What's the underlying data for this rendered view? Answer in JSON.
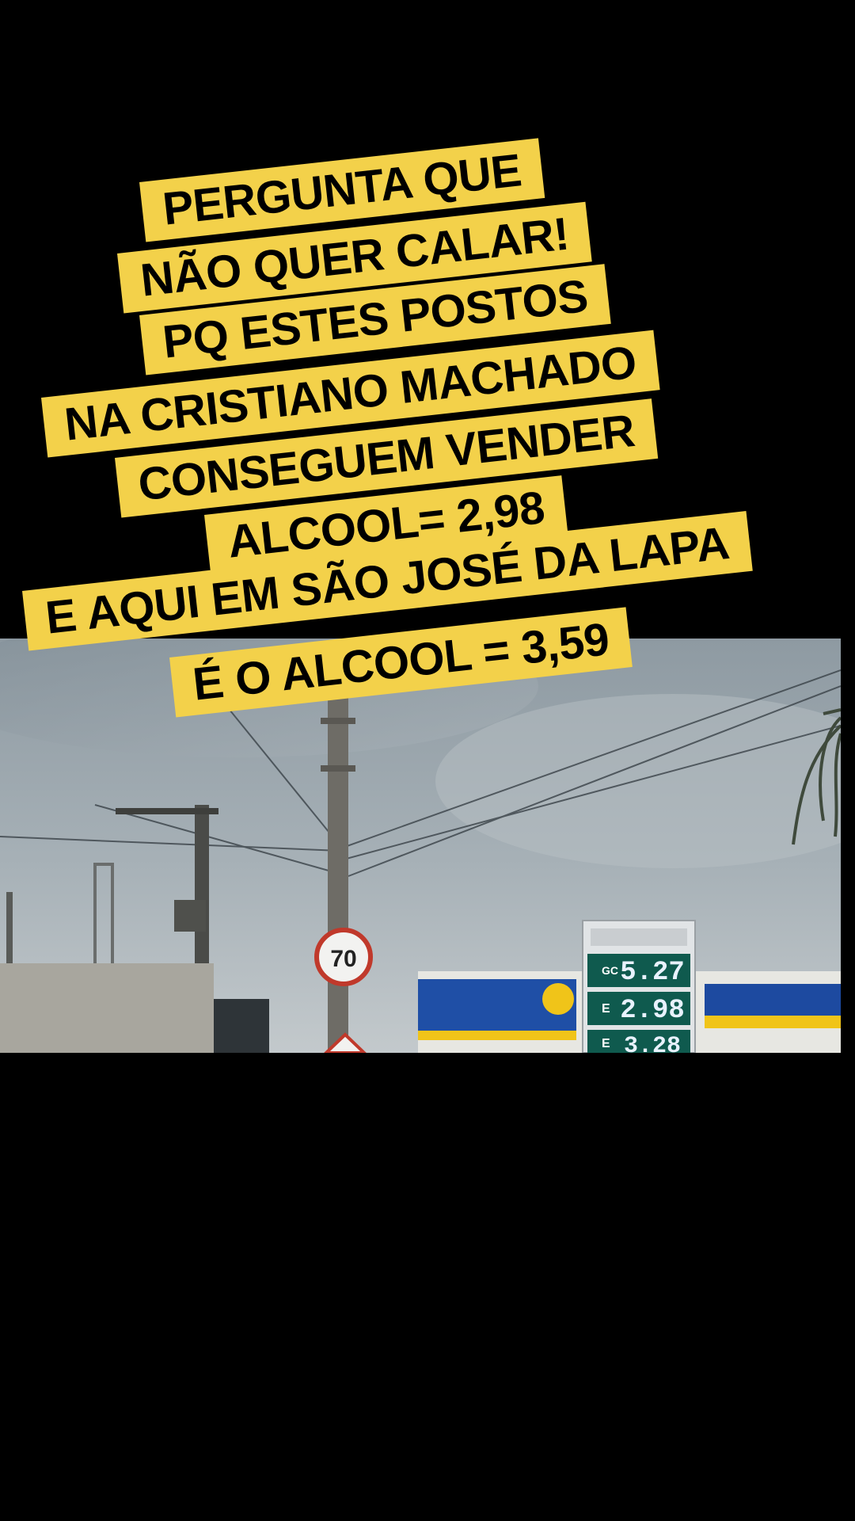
{
  "caption": {
    "lines": [
      "PERGUNTA QUE",
      "NÃO QUER CALAR!",
      "PQ ESTES POSTOS",
      "NA CRISTIANO MACHADO",
      "CONSEGUEM VENDER",
      "ALCOOL= 2,98",
      "E AQUI EM SÃO JOSÉ DA LAPA",
      "É O ALCOOL = 3,59"
    ]
  },
  "scene": {
    "speed_limit": "70",
    "price_sign": {
      "prices": [
        "5.27",
        "2.98",
        "3.28"
      ],
      "fuel_tags": [
        "GC",
        "E",
        "E"
      ]
    }
  },
  "colors": {
    "caption_bg": "#f3d14a",
    "caption_text": "#000000",
    "background": "#000000"
  }
}
